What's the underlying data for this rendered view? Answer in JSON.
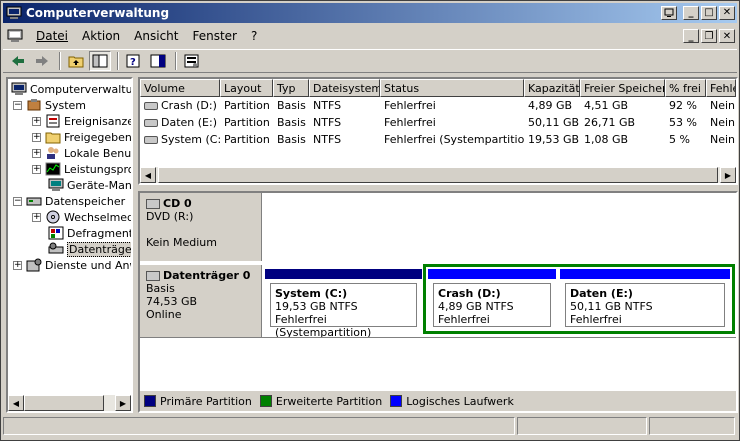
{
  "window": {
    "title": "Computerverwaltung"
  },
  "menu": {
    "items": [
      "Datei",
      "Aktion",
      "Ansicht",
      "Fenster",
      "?"
    ]
  },
  "tree": {
    "nodes": [
      {
        "label": "Computerverwaltung"
      },
      {
        "label": "System"
      },
      {
        "label": "Ereignisanzeige"
      },
      {
        "label": "Freigegebene Ordner"
      },
      {
        "label": "Lokale Benutzer"
      },
      {
        "label": "Leistungsprotokolle"
      },
      {
        "label": "Geräte-Manager"
      },
      {
        "label": "Datenspeicher"
      },
      {
        "label": "Wechselmedien"
      },
      {
        "label": "Defragmentierung"
      },
      {
        "label": "Datenträgerverwaltung"
      },
      {
        "label": "Dienste und Anwendungen"
      }
    ]
  },
  "volumes": {
    "headers": [
      "Volume",
      "Layout",
      "Typ",
      "Dateisystem",
      "Status",
      "Kapazität",
      "Freier Speicher",
      "% frei",
      "Fehle"
    ],
    "rows": [
      {
        "volume": "Crash (D:)",
        "layout": "Partition",
        "typ": "Basis",
        "fs": "NTFS",
        "status": "Fehlerfrei",
        "kap": "4,89 GB",
        "frei": "4,51 GB",
        "pct": "92 %",
        "fehl": "Nein"
      },
      {
        "volume": "Daten (E:)",
        "layout": "Partition",
        "typ": "Basis",
        "fs": "NTFS",
        "status": "Fehlerfrei",
        "kap": "50,11 GB",
        "frei": "26,71 GB",
        "pct": "53 %",
        "fehl": "Nein"
      },
      {
        "volume": "System (C:)",
        "layout": "Partition",
        "typ": "Basis",
        "fs": "NTFS",
        "status": "Fehlerfrei (Systempartition)",
        "kap": "19,53 GB",
        "frei": "1,08 GB",
        "pct": "5 %",
        "fehl": "Nein"
      }
    ]
  },
  "disks": {
    "cd": {
      "name": "CD 0",
      "type": "DVD (R:)",
      "state": "Kein Medium"
    },
    "d0": {
      "name": "Datenträger 0",
      "type": "Basis",
      "size": "74,53 GB",
      "state": "Online",
      "partitions": [
        {
          "name": "System  (C:)",
          "size": "19,53 GB NTFS",
          "status": "Fehlerfrei (Systempartition)"
        },
        {
          "name": "Crash  (D:)",
          "size": "4,89 GB NTFS",
          "status": "Fehlerfrei"
        },
        {
          "name": "Daten  (E:)",
          "size": "50,11 GB NTFS",
          "status": "Fehlerfrei"
        }
      ]
    }
  },
  "legend": {
    "primary": "Primäre Partition",
    "extended": "Erweiterte Partition",
    "logical": "Logisches Laufwerk"
  },
  "colors": {
    "primary": "#000080",
    "extended": "#008000",
    "logical": "#0000ff"
  }
}
